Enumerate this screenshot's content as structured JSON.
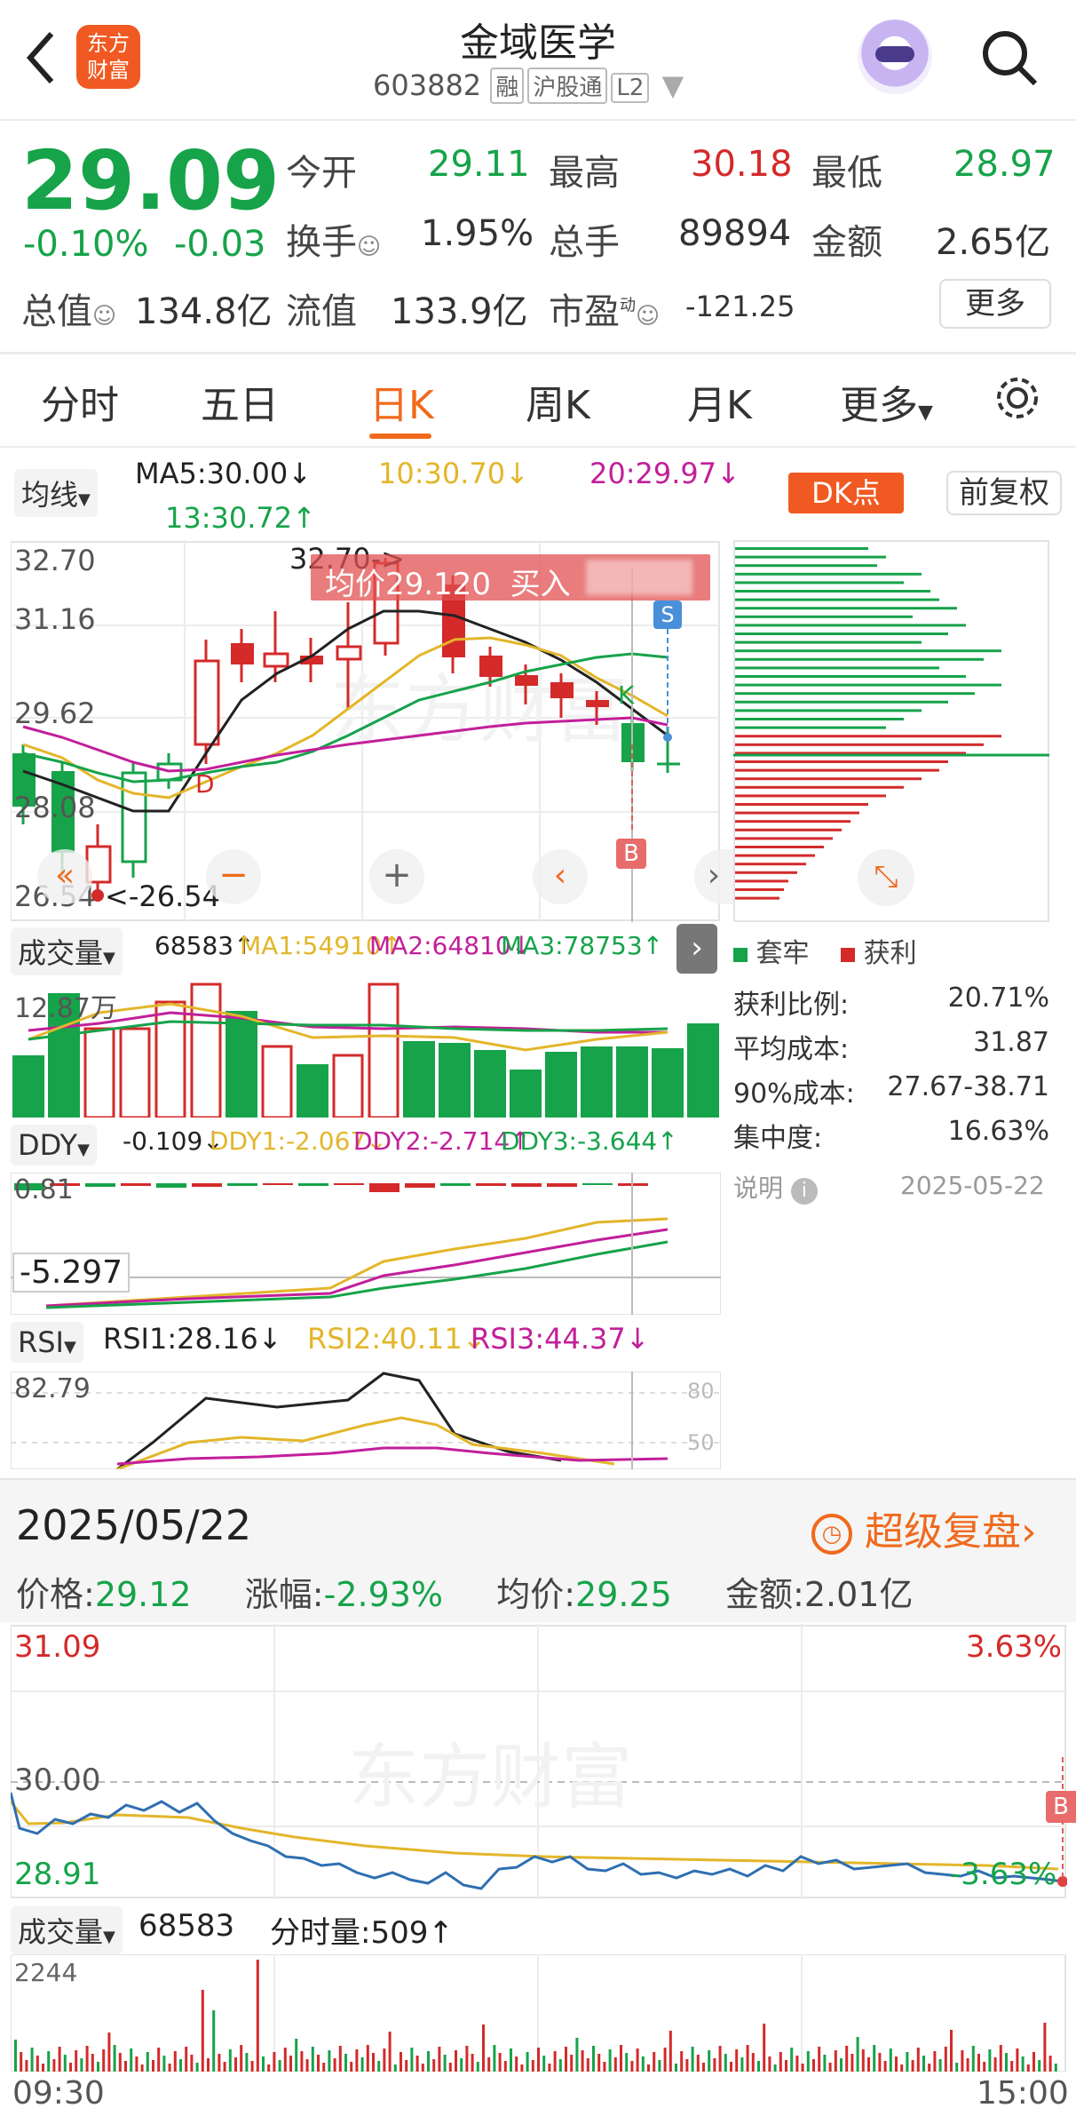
{
  "header": {
    "title": "金域医学",
    "code": "603882",
    "tags": [
      "融",
      "沪股通",
      "L2"
    ],
    "logo_text": "东方财富"
  },
  "quote": {
    "price": "29.09",
    "change_pct": "-0.10%",
    "change": "-0.03",
    "open_label": "今开",
    "open": "29.11",
    "high_label": "最高",
    "high": "30.18",
    "low_label": "最低",
    "low": "28.97",
    "turnover_label": "换手",
    "turnover": "1.95%",
    "volume_label": "总手",
    "volume": "89894",
    "amount_label": "金额",
    "amount": "2.65亿",
    "mktcap_label": "总值",
    "mktcap": "134.8亿",
    "float_label": "流值",
    "float": "133.9亿",
    "pe_label": "市盈",
    "pe_sup": "动",
    "pe": "-121.25",
    "more": "更多"
  },
  "tabs": [
    "分时",
    "五日",
    "日K",
    "周K",
    "月K",
    "更多"
  ],
  "active_tab": 2,
  "kline": {
    "ma_select": "均线",
    "ma5": "MA5:30.00↓",
    "ma10": "10:30.70↓",
    "ma20": "20:29.97↓",
    "ma13": "13:30.72↑",
    "dk": "DK点",
    "fq": "前复权",
    "y_labels": [
      "32.70",
      "31.16",
      "29.62",
      "28.08",
      "26.54"
    ],
    "high_note": "32.70->",
    "low_note": "<-26.54",
    "avg_banner": "均价29.120  买入",
    "marks": [
      "S",
      "K",
      "B",
      "D"
    ]
  },
  "chip": {
    "legend_trap": "套牢",
    "legend_profit": "获利",
    "rows": [
      {
        "label": "获利比例:",
        "value": "20.71%"
      },
      {
        "label": "平均成本:",
        "value": "31.87"
      },
      {
        "label": "90%成本:",
        "value": "27.67-38.71"
      },
      {
        "label": "集中度:",
        "value": "16.63%"
      }
    ],
    "note_label": "说明",
    "date": "2025-05-22"
  },
  "volume_panel": {
    "select": "成交量",
    "value": "68583↑",
    "ma1": "MA1:54910↑",
    "ma2": "MA2:64810↓",
    "ma3": "MA3:78753↑",
    "y_label": "12.87万"
  },
  "ddy_panel": {
    "select": "DDY",
    "value": "-0.109↓",
    "ddy1": "DDY1:-2.067↓",
    "ddy2": "DDY2:-2.714↑",
    "ddy3": "DDY3:-3.644↑",
    "y_top": "0.81",
    "cursor": "-5.297"
  },
  "rsi_panel": {
    "select": "RSI",
    "rsi1": "RSI1:28.16↓",
    "rsi2": "RSI2:40.11↓",
    "rsi3": "RSI3:44.37↓",
    "y_top": "82.79",
    "r80": "80",
    "r50": "50"
  },
  "intraday": {
    "date": "2025/05/22",
    "replay": "超级复盘",
    "price_label": "价格:",
    "price": "29.12",
    "chg_label": "涨幅:",
    "chg": "-2.93%",
    "avg_label": "均价:",
    "avg": "29.25",
    "amt_label": "金额:",
    "amt": "2.01亿",
    "y_top": "31.09",
    "y_mid": "30.00",
    "y_bot": "28.91",
    "pct_top": "3.63%",
    "pct_bot": "-3.63%",
    "vol_select": "成交量",
    "vol": "68583",
    "tick_label": "分时量:",
    "tick": "509↑",
    "vol_top": "2244",
    "t_start": "09:30",
    "t_end": "15:00",
    "mark": "B"
  },
  "colors": {
    "up": "#d42a2a",
    "down": "#16a34a",
    "accent": "#f06a1d"
  }
}
